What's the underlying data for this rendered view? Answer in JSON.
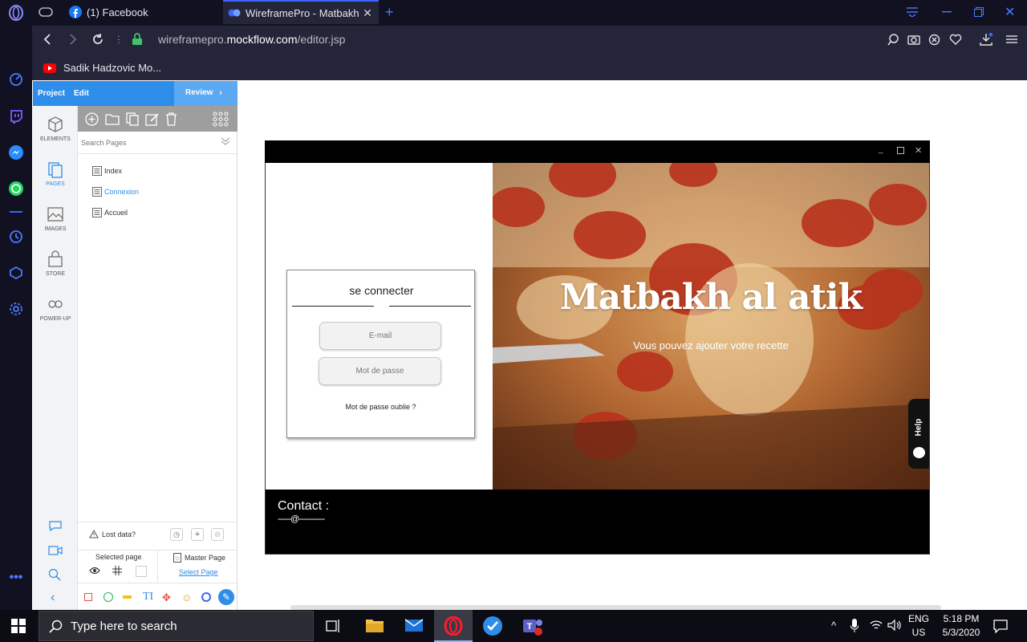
{
  "browser": {
    "tabs": [
      {
        "label": "(1) Facebook"
      },
      {
        "label": "WireframePro - Matbakh al"
      }
    ],
    "url": {
      "prefix": "wireframepro.",
      "domain": "mockflow.com",
      "path": "/editor.jsp"
    },
    "bookmark": "Sadik Hadzovic Mo..."
  },
  "mockflow": {
    "menu": {
      "project": "Project",
      "edit": "Edit",
      "review": "Review"
    },
    "side_icons": [
      {
        "label": "ELEMENTS",
        "icon": "cube-icon"
      },
      {
        "label": "PAGES",
        "icon": "pages-icon"
      },
      {
        "label": "IMAGES",
        "icon": "image-icon"
      },
      {
        "label": "STORE",
        "icon": "bag-icon"
      },
      {
        "label": "POWER-UP",
        "icon": "infinity-icon"
      }
    ],
    "search_placeholder": "Search Pages",
    "pages": [
      {
        "label": "Index"
      },
      {
        "label": "Connexion"
      },
      {
        "label": "Accueil"
      }
    ],
    "lost_data": "Lost data?",
    "selected_page": "Selected page",
    "master_page": "Master Page",
    "select_page": "Select Page"
  },
  "wireframe": {
    "login_title": "se connecter",
    "email_placeholder": "E-mail",
    "password_placeholder": "Mot de passe",
    "forgot": "Mot de passe oublie ?",
    "hero_title": "Matbakh al atik",
    "hero_subtitle": "Vous pouvez ajouter votre recette",
    "contact": "Contact :",
    "contact_line": "------@------------",
    "help": "Help"
  },
  "taskbar": {
    "search": "Type here to search",
    "lang1": "ENG",
    "lang2": "US",
    "time": "5:18 PM",
    "date": "5/3/2020"
  },
  "colors": {
    "accent": "#2e8de8",
    "opera_dark": "#111122"
  }
}
